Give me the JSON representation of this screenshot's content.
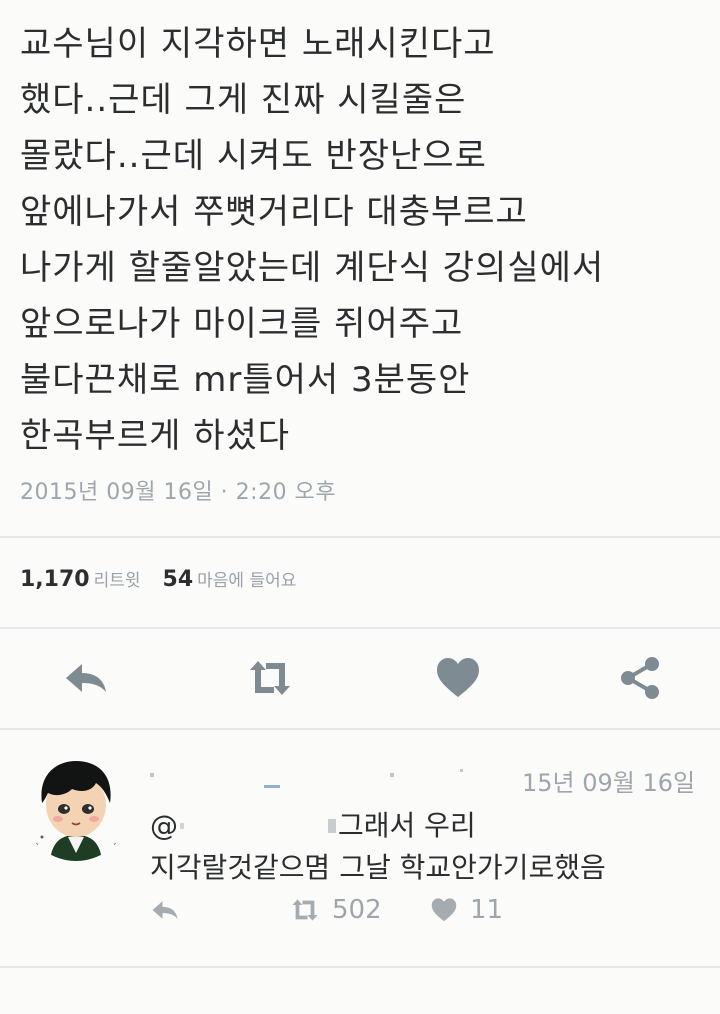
{
  "tweet": {
    "lines": [
      "교수님이 지각하면 노래시킨다고",
      "했다..근데 그게 진짜 시킬줄은",
      "몰랐다..근데 시켜도 반장난으로",
      "앞에나가서 쭈뼛거리다 대충부르고",
      "나가게 할줄알았는데 계단식 강의실에서",
      "앞으로나가 마이크를 쥐어주고",
      "불다끈채로 mr틀어서 3분동안",
      "한곡부르게 하셨다"
    ],
    "timestamp": "2015년 09월 16일 · 2:20 오후",
    "retweet_count": "1,170",
    "retweet_label": "리트윗",
    "like_count": "54",
    "like_label": "마음에 들어요"
  },
  "reply": {
    "date": "15년 09월 16일",
    "mention_prefix": "@",
    "line1_suffix": "그래서 우리",
    "line2": "지각랄것같으몀 그날 학교안가기로했음",
    "retweet_count": "502",
    "like_count": "11"
  },
  "icons": {
    "reply": "reply-icon",
    "retweet": "retweet-icon",
    "like": "heart-icon",
    "share": "share-icon"
  },
  "colors": {
    "background": "#fbfcfa",
    "text": "#2b2d2e",
    "muted": "#9ea5ab",
    "icon": "#7f8b92",
    "divider": "#e3e7ea"
  }
}
